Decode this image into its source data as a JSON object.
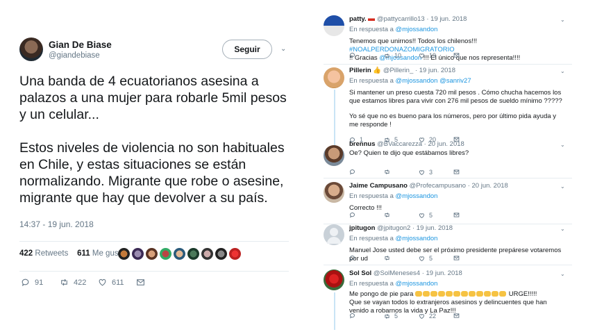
{
  "main_tweet": {
    "name": "Gian De Biase",
    "handle": "@giandebiase",
    "follow_label": "Seguir",
    "paragraph1": "Una banda de 4 ecuatorianos asesina a palazos a una mujer para robarle 5mil pesos y un celular...",
    "paragraph2": "Estos niveles de violencia no son habituales en Chile, y estas situaciones se están normalizando. Migrante que robe o asesine, migrante que hay que devolver a su país.",
    "timestamp": "14:37 - 19 jun. 2018",
    "retweets_count": "422",
    "retweets_label": "Retweets",
    "likes_count": "611",
    "likes_label": "Me gusta",
    "actions": {
      "replies": "91",
      "retweets": "422",
      "likes": "611"
    }
  },
  "replies": [
    {
      "name": "patty.",
      "handle": "@pattycarrillo13",
      "date": "19 jun. 2018",
      "reply_prefix": "En respuesta a",
      "reply_to": "@mjossandon",
      "text_parts": [
        "Tenemos que unirnos!!  Todos los chilenos!!! ",
        "#NOALPERDONAZOMIGRATORIO",
        " !! Gracias ",
        "@mjossandon",
        " !!! El único que nos representa!!!!"
      ],
      "counts": {
        "replies": "",
        "retweets": "10",
        "likes": "19"
      }
    },
    {
      "name": "Pillerin",
      "handle": "@Pillerin_",
      "date": "19 jun. 2018",
      "reply_prefix": "En respuesta a",
      "reply_to": "@mjossandon",
      "reply_to2": "@sanriv27",
      "text1": "Si mantener un preso cuesta 720 mil pesos . Cómo chucha hacemos los que estamos  libres para vivir con 276 mil pesos de sueldo mínimo ?????",
      "text2": "Yo sé que no es bueno para los números, pero por último pida ayuda y me responde !",
      "counts": {
        "replies": "1",
        "retweets": "5",
        "likes": "20"
      }
    },
    {
      "name": "brennus",
      "handle": "@BVaccarezza",
      "date": "20 jun. 2018",
      "text": "Oe? Quien te dijo que estábamos libres?",
      "counts": {
        "replies": "",
        "retweets": "",
        "likes": "3"
      }
    },
    {
      "name": "Jaime Campusano",
      "handle": "@Profecampusano",
      "date": "20 jun. 2018",
      "reply_prefix": "En respuesta a",
      "reply_to": "@mjossandon",
      "text": "Correcto !!!",
      "counts": {
        "replies": "",
        "retweets": "",
        "likes": "5"
      }
    },
    {
      "name": "jpitugon",
      "handle": "@jpitugon2",
      "date": "19 jun. 2018",
      "reply_prefix": "En respuesta a",
      "reply_to": "@mjossandon",
      "text": "Manuel Jose usted debe ser el próximo presidente prepárese votaremos por ud",
      "counts": {
        "replies": "",
        "retweets": "",
        "likes": "5"
      }
    },
    {
      "name": "Sol Sol",
      "handle": "@SolMeneses4",
      "date": "19 jun. 2018",
      "reply_prefix": "En respuesta a",
      "reply_to": "@mjossandon",
      "text_before": "Me  pongo de pie para ",
      "text_after": " URGE!!!!!",
      "text_rest": "Que se vayan todos lo extranjeros asesinos y delincuentes que han venido a robarnos la vida y La Paz!!!",
      "counts": {
        "replies": "",
        "retweets": "5",
        "likes": "22"
      }
    }
  ],
  "colors": {
    "link": "#1b95e0",
    "muted": "#657786",
    "thread": "#c9e4f5"
  }
}
